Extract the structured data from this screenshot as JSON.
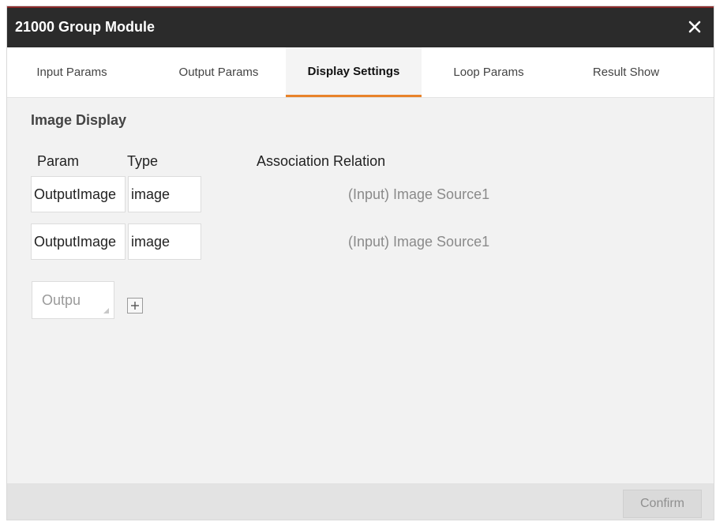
{
  "window": {
    "title": "21000 Group Module",
    "close_icon": "close-icon"
  },
  "tabs": [
    {
      "label": "Input Params"
    },
    {
      "label": "Output Params"
    },
    {
      "label": "Display Settings",
      "active": true
    },
    {
      "label": "Loop Params"
    },
    {
      "label": "Result Show"
    }
  ],
  "image_display": {
    "title": "Image Display",
    "headers": {
      "param": "Param",
      "type": "Type",
      "association": "Association Relation"
    },
    "rows": [
      {
        "param": "OutputImage",
        "type": "image",
        "association": "(Input) Image Source1"
      },
      {
        "param": "OutputImage",
        "type": "image",
        "association": "(Input) Image Source1"
      }
    ],
    "add_select": {
      "value": "Outpu"
    },
    "add_icon": "plus-icon"
  },
  "footer": {
    "confirm_label": "Confirm"
  },
  "colors": {
    "accent": "#e8832a",
    "titlebar": "#2b2b2b",
    "titlebar_top": "#8b2a2a"
  }
}
